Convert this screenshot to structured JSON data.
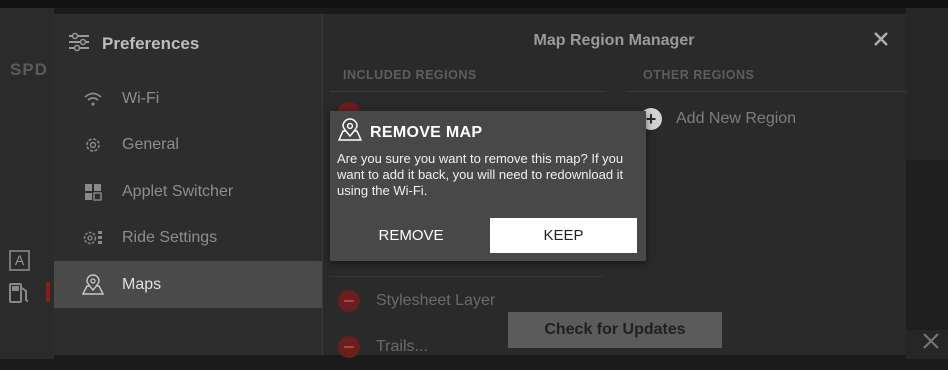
{
  "background": {
    "speed_label": "SPD",
    "mode_badge": "A"
  },
  "preferences": {
    "title": "Preferences",
    "nav_items": [
      {
        "label": "Wi-Fi",
        "icon": "wifi-icon"
      },
      {
        "label": "General",
        "icon": "gear-icon"
      },
      {
        "label": "Applet Switcher",
        "icon": "grid-icon"
      },
      {
        "label": "Ride Settings",
        "icon": "ride-settings-icon"
      },
      {
        "label": "Maps",
        "icon": "map-pin-icon",
        "active": true
      }
    ]
  },
  "region_manager": {
    "title": "Map Region Manager",
    "included_header": "INCLUDED REGIONS",
    "other_header": "OTHER REGIONS",
    "add_region_label": "Add New Region",
    "included_rows": [
      "Stylesheet Layer",
      "Trails..."
    ],
    "check_updates_label": "Check for Updates"
  },
  "modal": {
    "title": "REMOVE MAP",
    "message": "Are you sure you want to remove this map? If you want to add it back, you will need to redownload it using the Wi-Fi.",
    "remove_label": "REMOVE",
    "keep_label": "KEEP"
  },
  "colors": {
    "accent_red": "#6b1e1e",
    "active_item_bg": "#4a4a4a",
    "modal_bg": "#484848"
  }
}
